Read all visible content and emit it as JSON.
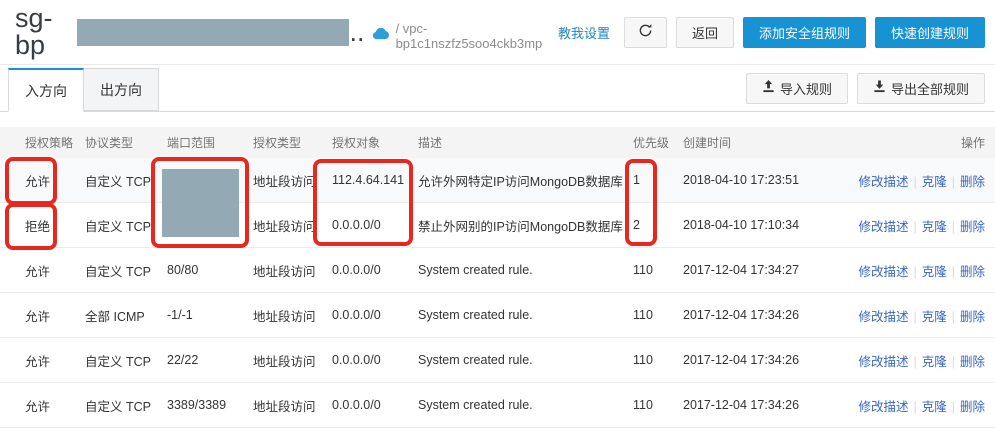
{
  "header": {
    "title_prefix": "sg-bp",
    "title_suffix": "..",
    "vpc_path": "/ vpc-bp1c1nszfz5soo4ckb3mp",
    "teach_link": "教我设置",
    "back_button": "返回",
    "add_rule_button": "添加安全组规则",
    "quick_create_button": "快速创建规则"
  },
  "tabs": {
    "inbound": "入方向",
    "outbound": "出方向"
  },
  "toolbar": {
    "import_button": "导入规则",
    "export_button": "导出全部规则"
  },
  "table": {
    "columns": [
      "授权策略",
      "协议类型",
      "端口范围",
      "授权类型",
      "授权对象",
      "描述",
      "优先级",
      "创建时间",
      "操作"
    ],
    "action_labels": [
      "修改描述",
      "克隆",
      "删除"
    ],
    "rows": [
      {
        "policy": "允许",
        "protocol": "自定义 TCP",
        "port": "",
        "auth_type": "地址段访问",
        "auth_object": "112.4.64.141",
        "description": "允许外网特定IP访问MongoDB数据库",
        "priority": "1",
        "created": "2018-04-10 17:23:51"
      },
      {
        "policy": "拒绝",
        "protocol": "自定义 TCP",
        "port": "",
        "auth_type": "地址段访问",
        "auth_object": "0.0.0.0/0",
        "description": "禁止外网别的IP访问MongoDB数据库",
        "priority": "2",
        "created": "2018-04-10 17:10:34"
      },
      {
        "policy": "允许",
        "protocol": "自定义 TCP",
        "port": "80/80",
        "auth_type": "地址段访问",
        "auth_object": "0.0.0.0/0",
        "description": "System created rule.",
        "priority": "110",
        "created": "2017-12-04 17:34:27"
      },
      {
        "policy": "允许",
        "protocol": "全部 ICMP",
        "port": "-1/-1",
        "auth_type": "地址段访问",
        "auth_object": "0.0.0.0/0",
        "description": "System created rule.",
        "priority": "110",
        "created": "2017-12-04 17:34:26"
      },
      {
        "policy": "允许",
        "protocol": "自定义 TCP",
        "port": "22/22",
        "auth_type": "地址段访问",
        "auth_object": "0.0.0.0/0",
        "description": "System created rule.",
        "priority": "110",
        "created": "2017-12-04 17:34:26"
      },
      {
        "policy": "允许",
        "protocol": "自定义 TCP",
        "port": "3389/3389",
        "auth_type": "地址段访问",
        "auth_object": "0.0.0.0/0",
        "description": "System created rule.",
        "priority": "110",
        "created": "2017-12-04 17:34:26"
      }
    ]
  },
  "icons": {
    "cloud_icon": "cloud",
    "refresh_icon": "refresh",
    "import_icon": "upload-arrow",
    "export_icon": "download-arrow"
  },
  "colors": {
    "primary_blue": "#1792d2",
    "link_blue": "#3a66c6",
    "annotation_red": "#e8281e",
    "redaction_gray": "#93aab5"
  }
}
